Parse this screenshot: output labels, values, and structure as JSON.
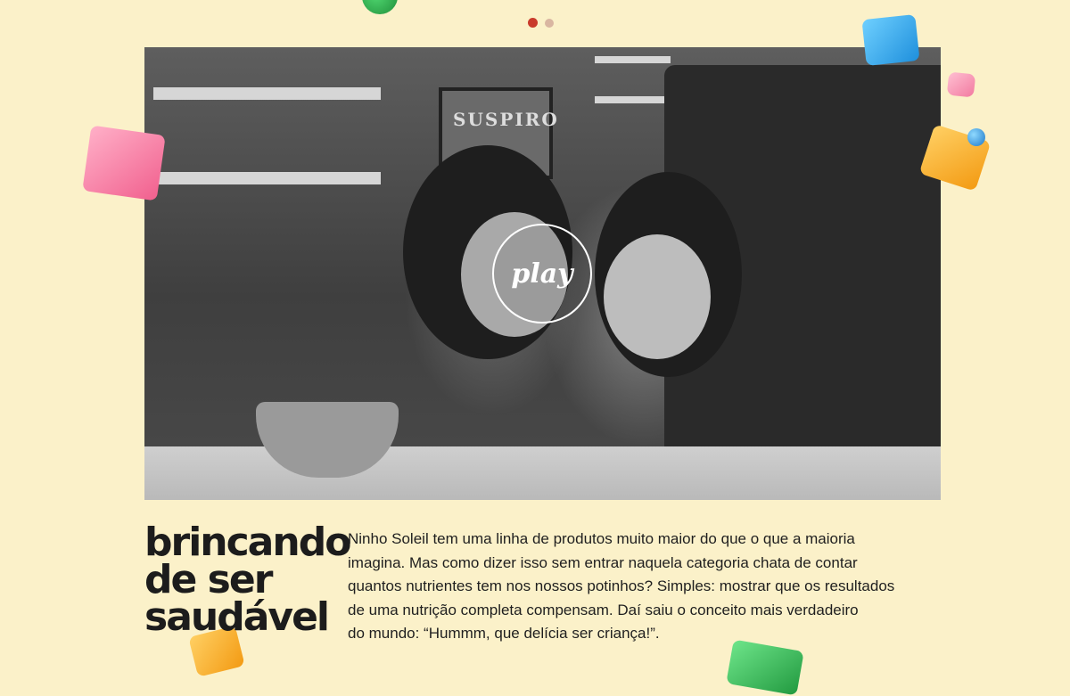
{
  "carousel": {
    "dots": [
      "slide-1",
      "slide-2"
    ],
    "active_index": 0
  },
  "video": {
    "play_label": "play",
    "scene_sign_text": "SUSPIRO"
  },
  "content": {
    "heading_lines": [
      "brincando",
      "de ser",
      "saudável"
    ],
    "paragraph_lines": [
      "Ninho Soleil tem uma linha de produtos muito maior do que o que a maioria",
      "imagina. Mas como dizer isso sem entrar naquela categoria chata de contar",
      "quantos nutrientes tem nos nossos potinhos? Simples: mostrar que os resultados",
      "de uma nutrição completa compensam. Daí saiu o conceito mais verdadeiro",
      "do mundo: “Hummm, que delícia ser criança!”."
    ]
  },
  "colors": {
    "background": "#fbf1c9",
    "dot_active": "#c93b2c",
    "cube_pink": "#f27aa0",
    "cube_blue": "#2a9fe6",
    "cube_orange": "#f6a41f",
    "cube_green": "#2ea64a"
  }
}
